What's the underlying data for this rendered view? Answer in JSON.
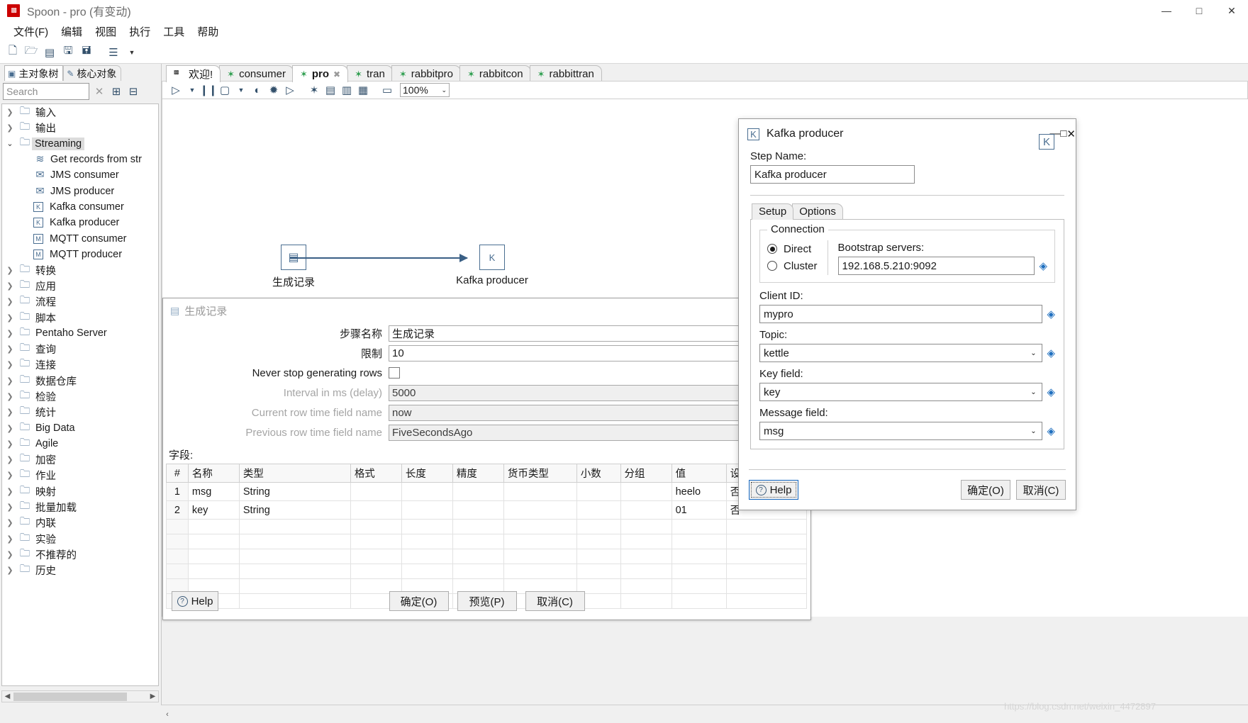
{
  "window": {
    "title": "Spoon - pro (有变动)",
    "app_icon": "spoon-icon",
    "controls": {
      "minimize": "—",
      "maximize": "□",
      "close": "✕"
    }
  },
  "menubar": {
    "items": [
      "文件(F)",
      "编辑",
      "视图",
      "执行",
      "工具",
      "帮助"
    ]
  },
  "toolbar": {
    "icons": [
      "new-file-icon",
      "open-file-icon",
      "explorer-icon",
      "save-icon",
      "save-as-icon",
      "layers-icon",
      "chevron-down-icon"
    ]
  },
  "left_panel": {
    "tabs": [
      {
        "label": "主对象树",
        "icon": "tree-icon",
        "active": false
      },
      {
        "label": "核心对象",
        "icon": "pencil-icon",
        "active": true
      }
    ],
    "search": {
      "placeholder": "Search",
      "value": ""
    },
    "search_icons": [
      "clear-x-icon",
      "expand-all-icon",
      "collapse-all-icon"
    ],
    "tree": [
      {
        "label": "输入",
        "kind": "folder",
        "state": "collapsed"
      },
      {
        "label": "输出",
        "kind": "folder",
        "state": "collapsed"
      },
      {
        "label": "Streaming",
        "kind": "folder",
        "state": "expanded",
        "selected": true
      },
      {
        "label": "Get records from str",
        "kind": "step",
        "icon": "stream-records-icon"
      },
      {
        "label": "JMS consumer",
        "kind": "step",
        "icon": "jms-consumer-icon"
      },
      {
        "label": "JMS producer",
        "kind": "step",
        "icon": "jms-producer-icon"
      },
      {
        "label": "Kafka consumer",
        "kind": "step",
        "icon": "kafka-consumer-icon"
      },
      {
        "label": "Kafka producer",
        "kind": "step",
        "icon": "kafka-producer-icon"
      },
      {
        "label": "MQTT consumer",
        "kind": "step",
        "icon": "mqtt-consumer-icon"
      },
      {
        "label": "MQTT producer",
        "kind": "step",
        "icon": "mqtt-producer-icon"
      },
      {
        "label": "转换",
        "kind": "folder",
        "state": "collapsed"
      },
      {
        "label": "应用",
        "kind": "folder",
        "state": "collapsed"
      },
      {
        "label": "流程",
        "kind": "folder",
        "state": "collapsed"
      },
      {
        "label": "脚本",
        "kind": "folder",
        "state": "collapsed"
      },
      {
        "label": "Pentaho Server",
        "kind": "folder",
        "state": "collapsed"
      },
      {
        "label": "查询",
        "kind": "folder",
        "state": "collapsed"
      },
      {
        "label": "连接",
        "kind": "folder",
        "state": "collapsed"
      },
      {
        "label": "数据仓库",
        "kind": "folder",
        "state": "collapsed"
      },
      {
        "label": "检验",
        "kind": "folder",
        "state": "collapsed"
      },
      {
        "label": "统计",
        "kind": "folder",
        "state": "collapsed"
      },
      {
        "label": "Big Data",
        "kind": "folder",
        "state": "collapsed"
      },
      {
        "label": "Agile",
        "kind": "folder",
        "state": "collapsed"
      },
      {
        "label": "加密",
        "kind": "folder",
        "state": "collapsed"
      },
      {
        "label": "作业",
        "kind": "folder",
        "state": "collapsed"
      },
      {
        "label": "映射",
        "kind": "folder",
        "state": "collapsed"
      },
      {
        "label": "批量加载",
        "kind": "folder",
        "state": "collapsed"
      },
      {
        "label": "内联",
        "kind": "folder",
        "state": "collapsed"
      },
      {
        "label": "实验",
        "kind": "folder",
        "state": "collapsed"
      },
      {
        "label": "不推荐的",
        "kind": "folder",
        "state": "collapsed"
      },
      {
        "label": "历史",
        "kind": "folder",
        "state": "collapsed"
      }
    ]
  },
  "editor_tabs": [
    {
      "label": "欢迎!",
      "icon": "spoon-icon",
      "active": false,
      "closable": false
    },
    {
      "label": "consumer",
      "icon": "transformation-icon",
      "active": false,
      "closable": false
    },
    {
      "label": "pro",
      "icon": "transformation-icon",
      "active": true,
      "closable": true
    },
    {
      "label": "tran",
      "icon": "transformation-icon",
      "active": false,
      "closable": false
    },
    {
      "label": "rabbitpro",
      "icon": "transformation-icon",
      "active": false,
      "closable": false
    },
    {
      "label": "rabbitcon",
      "icon": "transformation-icon",
      "active": false,
      "closable": false
    },
    {
      "label": "rabbittran",
      "icon": "transformation-icon",
      "active": false,
      "closable": false
    }
  ],
  "canvas_toolbar": {
    "icons": [
      "run-icon",
      "run-options-chevron-icon",
      "pause-icon",
      "stop-icon",
      "stop-options-chevron-icon",
      "preview-icon",
      "debug-icon",
      "replay-icon",
      "verify-icon",
      "impact-icon",
      "sql-icon",
      "inspect-icon",
      "grid-icon"
    ],
    "zoom": "100%"
  },
  "canvas": {
    "nodes": [
      {
        "name": "生成记录",
        "icon": "generate-rows-icon"
      },
      {
        "name": "Kafka producer",
        "icon": "kafka-producer-icon"
      }
    ],
    "hop": {
      "from": "生成记录",
      "to": "Kafka producer"
    }
  },
  "generate_rows_dialog": {
    "title": "生成记录",
    "icon": "generate-rows-icon",
    "minimize": "—",
    "fields": [
      {
        "label": "步骤名称",
        "value": "生成记录",
        "disabled": false,
        "type": "text"
      },
      {
        "label": "限制",
        "value": "10",
        "disabled": false,
        "type": "text"
      },
      {
        "label": "Never stop generating rows",
        "value": "",
        "disabled": false,
        "type": "checkbox",
        "checked": false
      },
      {
        "label": "Interval in ms (delay)",
        "value": "5000",
        "disabled": true,
        "type": "text"
      },
      {
        "label": "Current row time field name",
        "value": "now",
        "disabled": true,
        "type": "text"
      },
      {
        "label": "Previous row time field name",
        "value": "FiveSecondsAgo",
        "disabled": true,
        "type": "text"
      }
    ],
    "fields_label": "字段:",
    "grid": {
      "columns": [
        "#",
        "名称",
        "类型",
        "格式",
        "长度",
        "精度",
        "货币类型",
        "小数",
        "分组",
        "值",
        "设为空串?"
      ],
      "rows": [
        [
          "1",
          "msg",
          "String",
          "",
          "",
          "",
          "",
          "",
          "",
          "heelo",
          "否"
        ],
        [
          "2",
          "key",
          "String",
          "",
          "",
          "",
          "",
          "",
          "",
          "01",
          "否"
        ]
      ],
      "empty_rows": 6
    },
    "buttons": {
      "help": "Help",
      "ok": "确定(O)",
      "preview": "预览(P)",
      "cancel": "取消(C)"
    }
  },
  "kafka_dialog": {
    "title": "Kafka producer",
    "icon": "kafka-producer-icon",
    "controls": {
      "minimize": "—",
      "maximize": "□",
      "close": "✕"
    },
    "step_name_label": "Step Name:",
    "step_name_value": "Kafka producer",
    "step_icon": "kafka-producer-icon",
    "tabs": [
      {
        "label": "Setup",
        "active": true
      },
      {
        "label": "Options",
        "active": false
      }
    ],
    "connection": {
      "group_title": "Connection",
      "options": [
        {
          "label": "Direct",
          "selected": true
        },
        {
          "label": "Cluster",
          "selected": false
        }
      ],
      "bootstrap_label": "Bootstrap servers:",
      "bootstrap_value": "192.168.5.210:9092"
    },
    "client_id": {
      "label": "Client ID:",
      "value": "mypro"
    },
    "topic": {
      "label": "Topic:",
      "value": "kettle"
    },
    "key_field": {
      "label": "Key field:",
      "value": "key"
    },
    "message_field": {
      "label": "Message field:",
      "value": "msg"
    },
    "buttons": {
      "help": "Help",
      "ok": "确定(O)",
      "cancel": "取消(C)"
    }
  },
  "statusbar": {
    "left_arrow": "‹",
    "watermark": "https://blog.csdn.net/weixin_4472897"
  },
  "colors": {
    "accent": "#4a6e91",
    "hop": "#3a5f85",
    "tab_green": "#2e9e4f",
    "title_red": "#cc0000",
    "focus_blue": "#1668c1"
  }
}
